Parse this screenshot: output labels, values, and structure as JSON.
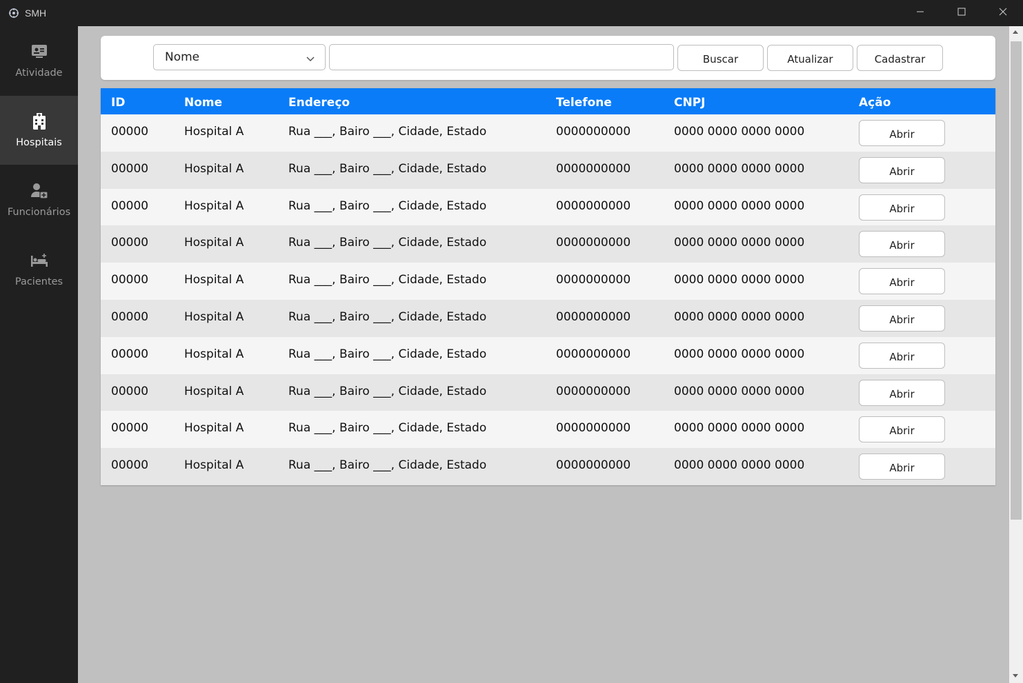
{
  "window": {
    "title": "SMH",
    "controls": [
      "minimize-icon",
      "maximize-icon",
      "close-icon"
    ]
  },
  "sidebar": {
    "items": [
      {
        "label": "Atividade",
        "icon": "activity-icon",
        "active": false
      },
      {
        "label": "Hospitais",
        "icon": "hospital-icon",
        "active": true
      },
      {
        "label": "Funcionários",
        "icon": "staff-icon",
        "active": false
      },
      {
        "label": "Pacientes",
        "icon": "bed-icon",
        "active": false
      }
    ]
  },
  "toolbar": {
    "filter_selected": "Nome",
    "search_value": "",
    "buscar_label": "Buscar",
    "atualizar_label": "Atualizar",
    "cadastrar_label": "Cadastrar"
  },
  "table": {
    "headers": [
      "ID",
      "Nome",
      "Endereço",
      "Telefone",
      "CNPJ",
      "Ação"
    ],
    "rows": [
      {
        "id": "00000",
        "nome": "Hospital A",
        "endereco": "Rua ___, Bairo ___, Cidade, Estado",
        "telefone": "0000000000",
        "cnpj": "0000 0000 0000 0000",
        "acao": "Abrir"
      },
      {
        "id": "00000",
        "nome": "Hospital A",
        "endereco": "Rua ___, Bairo ___, Cidade, Estado",
        "telefone": "0000000000",
        "cnpj": "0000 0000 0000 0000",
        "acao": "Abrir"
      },
      {
        "id": "00000",
        "nome": "Hospital A",
        "endereco": "Rua ___, Bairo ___, Cidade, Estado",
        "telefone": "0000000000",
        "cnpj": "0000 0000 0000 0000",
        "acao": "Abrir"
      },
      {
        "id": "00000",
        "nome": "Hospital A",
        "endereco": "Rua ___, Bairo ___, Cidade, Estado",
        "telefone": "0000000000",
        "cnpj": "0000 0000 0000 0000",
        "acao": "Abrir"
      },
      {
        "id": "00000",
        "nome": "Hospital A",
        "endereco": "Rua ___, Bairo ___, Cidade, Estado",
        "telefone": "0000000000",
        "cnpj": "0000 0000 0000 0000",
        "acao": "Abrir"
      },
      {
        "id": "00000",
        "nome": "Hospital A",
        "endereco": "Rua ___, Bairo ___, Cidade, Estado",
        "telefone": "0000000000",
        "cnpj": "0000 0000 0000 0000",
        "acao": "Abrir"
      },
      {
        "id": "00000",
        "nome": "Hospital A",
        "endereco": "Rua ___, Bairo ___, Cidade, Estado",
        "telefone": "0000000000",
        "cnpj": "0000 0000 0000 0000",
        "acao": "Abrir"
      },
      {
        "id": "00000",
        "nome": "Hospital A",
        "endereco": "Rua ___, Bairo ___, Cidade, Estado",
        "telefone": "0000000000",
        "cnpj": "0000 0000 0000 0000",
        "acao": "Abrir"
      },
      {
        "id": "00000",
        "nome": "Hospital A",
        "endereco": "Rua ___, Bairo ___, Cidade, Estado",
        "telefone": "0000000000",
        "cnpj": "0000 0000 0000 0000",
        "acao": "Abrir"
      },
      {
        "id": "00000",
        "nome": "Hospital A",
        "endereco": "Rua ___, Bairo ___, Cidade, Estado",
        "telefone": "0000000000",
        "cnpj": "0000 0000 0000 0000",
        "acao": "Abrir"
      }
    ]
  },
  "colors": {
    "header_blue": "#0a7cf8",
    "sidebar_bg": "#202020",
    "sidebar_active": "#383838",
    "main_bg": "#c0c0c0"
  }
}
